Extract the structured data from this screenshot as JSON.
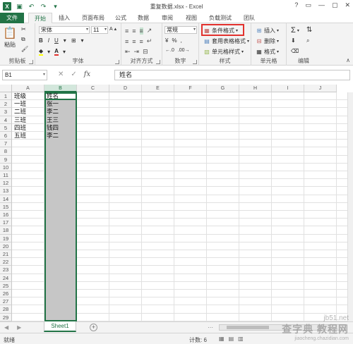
{
  "app": {
    "window_title": "重复数据.xlsx - Excel",
    "window_controls": [
      "?",
      "▭",
      "—",
      "▢",
      "✕"
    ]
  },
  "qat": {
    "save_icon": "save-icon",
    "undo_icon": "undo-icon",
    "redo_icon": "redo-icon"
  },
  "tabs": [
    "文件",
    "开始",
    "插入",
    "页面布局",
    "公式",
    "数据",
    "审阅",
    "视图",
    "负载测试",
    "团队"
  ],
  "active_tab": "开始",
  "ribbon": {
    "clipboard": {
      "label": "剪贴板",
      "paste": "粘贴"
    },
    "font": {
      "label": "字体",
      "font_name": "宋体",
      "font_size": "11",
      "bold": "B",
      "italic": "I",
      "underline": "U",
      "grow": "A",
      "shrink": "A",
      "font_color": "A",
      "fill_color": "wén"
    },
    "alignment": {
      "label": "对齐方式"
    },
    "number": {
      "label": "数字",
      "format": "常规",
      "percent": "%",
      "comma": ",",
      "currency": "¥"
    },
    "styles": {
      "label": "样式",
      "conditional": "条件格式",
      "table": "套用表格格式",
      "cell_styles": "单元格样式"
    },
    "cells": {
      "label": "单元格",
      "insert": "插入",
      "delete": "删除",
      "format": "格式"
    },
    "editing": {
      "label": "编辑",
      "sum": "Σ"
    },
    "highlight_color": "#e2312d",
    "accent": "#217346"
  },
  "formula_bar": {
    "name_box": "B1",
    "cancel": "✕",
    "enter": "✓",
    "fx": "fx",
    "content": "姓名"
  },
  "grid": {
    "columns": [
      "A",
      "B",
      "C",
      "D",
      "E",
      "F",
      "G",
      "H",
      "I",
      "J"
    ],
    "selected_column": "B",
    "rows": [
      "1",
      "2",
      "3",
      "4",
      "5",
      "6",
      "7",
      "8",
      "9",
      "10",
      "11",
      "12",
      "13",
      "14",
      "15",
      "16",
      "17",
      "18",
      "19",
      "20",
      "21",
      "22",
      "23",
      "24",
      "25",
      "26",
      "27",
      "28",
      "29"
    ],
    "cells": [
      {
        "ref": "A1",
        "value": "班级"
      },
      {
        "ref": "B1",
        "value": "姓名"
      },
      {
        "ref": "A2",
        "value": "一班"
      },
      {
        "ref": "B2",
        "value": "张一"
      },
      {
        "ref": "A3",
        "value": "二班"
      },
      {
        "ref": "B3",
        "value": "李二"
      },
      {
        "ref": "A4",
        "value": "三班"
      },
      {
        "ref": "B4",
        "value": "王三"
      },
      {
        "ref": "A5",
        "value": "四班"
      },
      {
        "ref": "B5",
        "value": "钱四"
      },
      {
        "ref": "A6",
        "value": "五班"
      },
      {
        "ref": "B6",
        "value": "李二"
      }
    ]
  },
  "sheets": {
    "nav_prev": "◀",
    "nav_next": "▶",
    "active": "Sheet1",
    "add": "+",
    "more": "⋯"
  },
  "status": {
    "ready": "就绪",
    "count": "计数: 6"
  },
  "watermark": {
    "line1": "查字典 教程网",
    "line2": "jiaocheng.chazidian.com",
    "site": "jb51.net"
  }
}
